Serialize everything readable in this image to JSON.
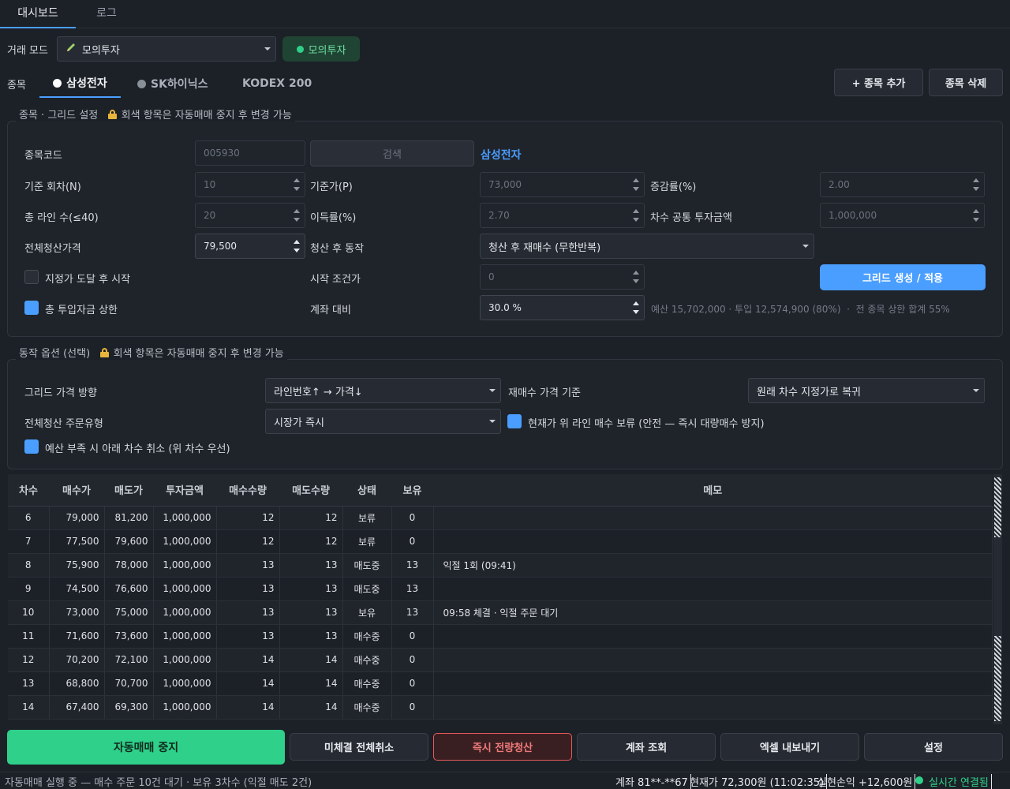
{
  "tabs": [
    "대시보드",
    "로그"
  ],
  "mode": {
    "label": "거래 모드",
    "value": "모의투자",
    "badge": "모의투자"
  },
  "stocks": {
    "label": "종목",
    "items": [
      "삼성전자",
      "SK하이닉스",
      "KODEX 200"
    ],
    "add": "+ 종목 추가",
    "remove": "종목 삭제"
  },
  "grid_settings": {
    "title": "종목 · 그리드 설정",
    "lock_note": "회색 항목은 자동매매 중지 후 변경 가능",
    "code_label": "종목코드",
    "code_value": "005930",
    "search": "검색",
    "stock_name": "삼성전자",
    "base_round_label": "기준 회차(N)",
    "base_round": "10",
    "base_price_label": "기준가(P)",
    "base_price": "73,000",
    "step_label": "증감률(%)",
    "step": "2.00",
    "lines_label": "총 라인 수(≤40)",
    "lines": "20",
    "profit_label": "이득률(%)",
    "profit": "2.70",
    "invest_label": "차수 공통 투자금액",
    "invest": "1,000,000",
    "liq_price_label": "전체청산가격",
    "liq_price": "79,500",
    "after_liq_label": "청산 후 동작",
    "after_liq": "청산 후 재매수 (무한반복)",
    "start_at_label": "지정가 도달 후 시작",
    "start_cond_label": "시작 조건가",
    "start_cond": "0",
    "apply": "그리드 생성 / 적용",
    "cap_label": "총 투입자금 상한",
    "ratio_label": "계좌 대비",
    "ratio": "30.0 %",
    "budget_hint": "예산 15,702,000 · 투입 12,574,900 (80%)  ·  전 종목 상한 합계 55%"
  },
  "options": {
    "title": "동작 옵션 (선택)",
    "lock_note": "회색 항목은 자동매매 중지 후 변경 가능",
    "direction_label": "그리드 가격 방향",
    "direction": "라인번호↑ → 가격↓",
    "rebuy_label": "재매수 가격 기준",
    "rebuy": "원래 차수 지정가로 복귀",
    "liq_type_label": "전체청산 주문유형",
    "liq_type": "시장가 즉시",
    "hold_above": "현재가 위 라인 매수 보류 (안전 — 즉시 대량매수 방지)",
    "cancel_below": "예산 부족 시 아래 차수 취소 (위 차수 우선)"
  },
  "table": {
    "headers": [
      "차수",
      "매수가",
      "매도가",
      "투자금액",
      "매수수량",
      "매도수량",
      "상태",
      "보유",
      "메모"
    ],
    "rows": [
      [
        "6",
        "79,000",
        "81,200",
        "1,000,000",
        "12",
        "12",
        "보류",
        "0",
        ""
      ],
      [
        "7",
        "77,500",
        "79,600",
        "1,000,000",
        "12",
        "12",
        "보류",
        "0",
        ""
      ],
      [
        "8",
        "75,900",
        "78,000",
        "1,000,000",
        "13",
        "13",
        "매도중",
        "13",
        "익절 1회 (09:41)"
      ],
      [
        "9",
        "74,500",
        "76,600",
        "1,000,000",
        "13",
        "13",
        "매도중",
        "13",
        ""
      ],
      [
        "10",
        "73,000",
        "75,000",
        "1,000,000",
        "13",
        "13",
        "보유",
        "13",
        "09:58 체결 · 익절 주문 대기"
      ],
      [
        "11",
        "71,600",
        "73,600",
        "1,000,000",
        "13",
        "13",
        "매수중",
        "0",
        ""
      ],
      [
        "12",
        "70,200",
        "72,100",
        "1,000,000",
        "14",
        "14",
        "매수중",
        "0",
        ""
      ],
      [
        "13",
        "68,800",
        "70,700",
        "1,000,000",
        "14",
        "14",
        "매수중",
        "0",
        ""
      ],
      [
        "14",
        "67,400",
        "69,300",
        "1,000,000",
        "14",
        "14",
        "매수중",
        "0",
        ""
      ]
    ]
  },
  "actions": {
    "stop": "자동매매 중지",
    "cancel_all": "미체결 전체취소",
    "liquidate": "즉시 전량청산",
    "account": "계좌 조회",
    "export": "엑셀 내보내기",
    "settings": "설정"
  },
  "status": {
    "left": "자동매매 실행 중 — 매수 주문 10건 대기 · 보유 3차수 (익절 매도 2건)",
    "account": "계좌 81**-**67",
    "price": "현재가 72,300원 (11:02:35)",
    "pnl": "실현손익 +12,600원",
    "conn": "실시간 연결됨"
  },
  "colors": {
    "accent": "#4a9eff",
    "green": "#2fd08a",
    "red": "#e85a5a"
  }
}
